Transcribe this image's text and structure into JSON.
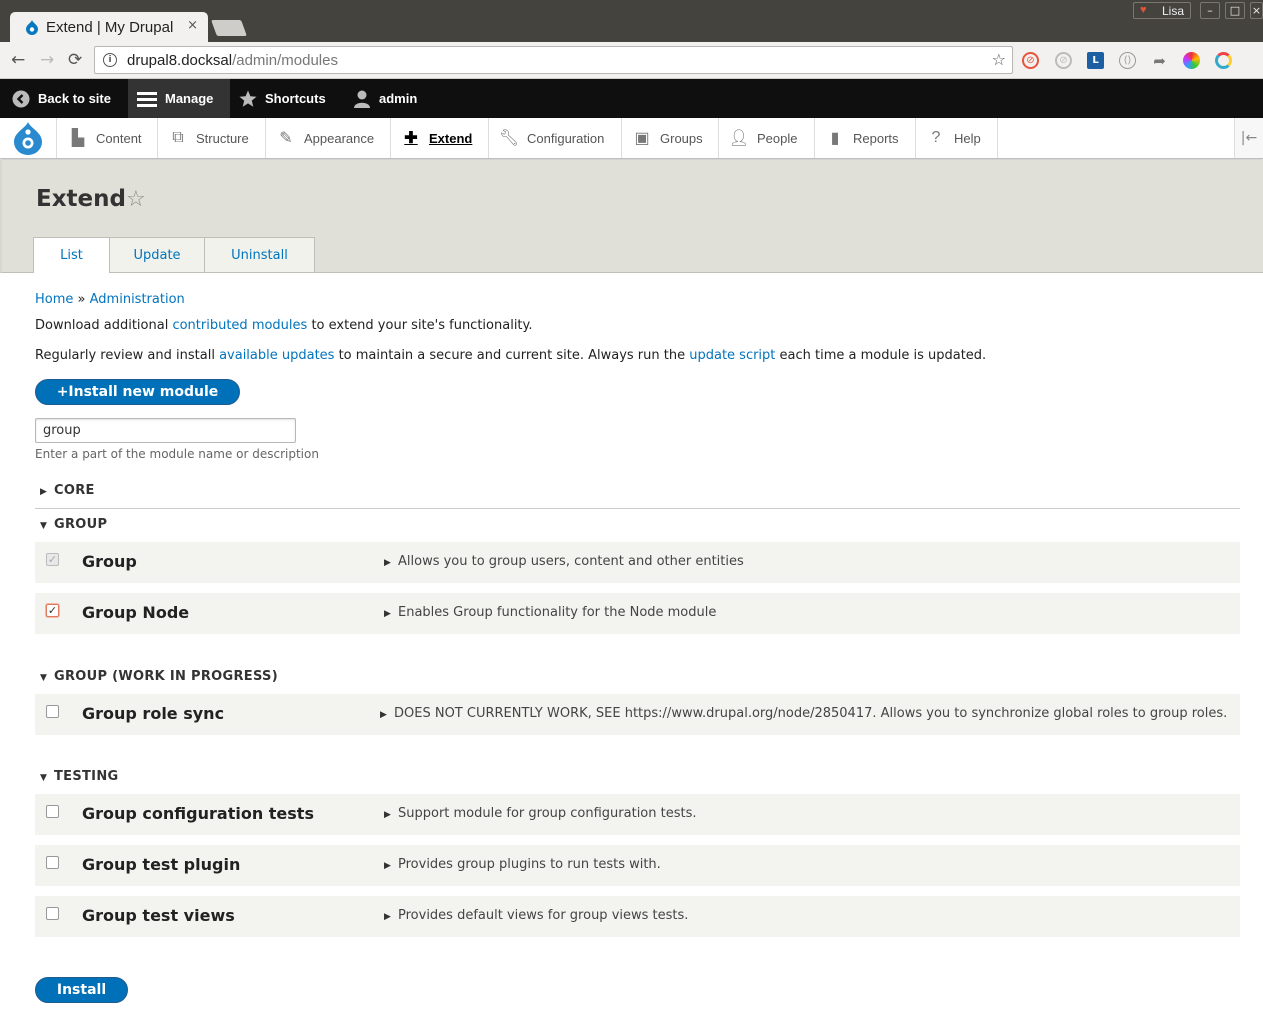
{
  "browser": {
    "tab_title": "Extend | My Drupal",
    "tab_close": "×",
    "profile_name": "Lisa",
    "window_buttons": [
      "–",
      "□",
      "×"
    ],
    "url_host": "drupal8.docksal",
    "url_path": "/admin/modules",
    "nav": [
      "←",
      "→",
      "⟳"
    ]
  },
  "toolbar": {
    "back_to_site": "Back to site",
    "manage": "Manage",
    "shortcuts": "Shortcuts",
    "user": "admin"
  },
  "tray": {
    "items": [
      "Content",
      "Structure",
      "Appearance",
      "Extend",
      "Configuration",
      "Groups",
      "People",
      "Reports",
      "Help"
    ],
    "active": "Extend"
  },
  "page": {
    "title": "Extend",
    "tabs": [
      "List",
      "Update",
      "Uninstall"
    ],
    "active_tab": "List"
  },
  "breadcrumb": {
    "home": "Home",
    "sep": "»",
    "admin": "Administration"
  },
  "intro": {
    "p1_before": "Download additional ",
    "p1_link": "contributed modules",
    "p1_after": " to extend your site's functionality.",
    "p2_before": "Regularly review and install ",
    "p2_link1": "available updates",
    "p2_middle": " to maintain a secure and current site. Always run the ",
    "p2_link2": "update script",
    "p2_after": " each time a module is updated."
  },
  "install_new_button": "+Install new module",
  "filter": {
    "value": "group",
    "description": "Enter a part of the module name or description"
  },
  "sections": {
    "core": "CORE",
    "group": "GROUP",
    "wip": "GROUP (WORK IN PROGRESS)",
    "testing": "TESTING"
  },
  "modules": {
    "group": {
      "name": "Group",
      "desc": "Allows you to group users, content and other entities",
      "checked": true,
      "disabled": true
    },
    "group_node": {
      "name": "Group Node",
      "desc": "Enables Group functionality for the Node module",
      "checked": true,
      "disabled": false
    },
    "group_role_sync": {
      "name": "Group role sync",
      "desc": "DOES NOT CURRENTLY WORK, SEE https://www.drupal.org/node/2850417. Allows you to synchronize global roles to group roles.",
      "checked": false
    },
    "group_config_tests": {
      "name": "Group configuration tests",
      "desc": "Support module for group configuration tests.",
      "checked": false
    },
    "group_test_plugin": {
      "name": "Group test plugin",
      "desc": "Provides group plugins to run tests with.",
      "checked": false
    },
    "group_test_views": {
      "name": "Group test views",
      "desc": "Provides default views for group views tests.",
      "checked": false
    }
  },
  "install_button": "Install",
  "colors": {
    "link": "#0074bd",
    "button": "#0071b8",
    "toolbar_bg": "#0f0f0f",
    "header_bg": "#e0e0d8",
    "row_bg": "#f3f3ef"
  }
}
